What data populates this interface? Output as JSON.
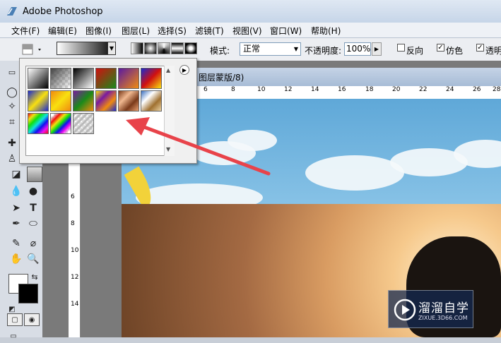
{
  "window": {
    "title": "Adobe Photoshop"
  },
  "menu": [
    "文件(F)",
    "编辑(E)",
    "图像(I)",
    "图层(L)",
    "选择(S)",
    "滤镜(T)",
    "视图(V)",
    "窗口(W)",
    "帮助(H)"
  ],
  "options": {
    "mode_label": "模式:",
    "mode_value": "正常",
    "opacity_label": "不透明度:",
    "opacity_value": "100%",
    "reverse_label": "反向",
    "dither_label": "仿色",
    "transparency_label": "透明",
    "reverse_checked": false,
    "dither_checked": true,
    "transparency_checked": true
  },
  "document": {
    "tab_title": "图层蒙版/8)"
  },
  "rulers": {
    "top": [
      "6",
      "8",
      "10",
      "12",
      "14",
      "16",
      "18",
      "20",
      "22",
      "24",
      "26",
      "28"
    ],
    "left": [
      "6",
      "8",
      "10",
      "12",
      "14"
    ]
  },
  "gradient_presets": [
    "foreground-to-background",
    "foreground-to-transparent",
    "black-white",
    "red-green",
    "violet-orange",
    "blue-red-yellow",
    "blue-yellow-blue",
    "orange-yellow-orange",
    "violet-green-orange",
    "yellow-violet-orange-blue",
    "copper",
    "chrome",
    "spectrum",
    "transparent-rainbow",
    "transparent-stripes"
  ],
  "watermark": {
    "title": "溜溜自学",
    "url": "ZIXUE.3D66.COM"
  },
  "colors": {
    "accent": "#e8434a",
    "title_bar": "#c6d5e8"
  }
}
